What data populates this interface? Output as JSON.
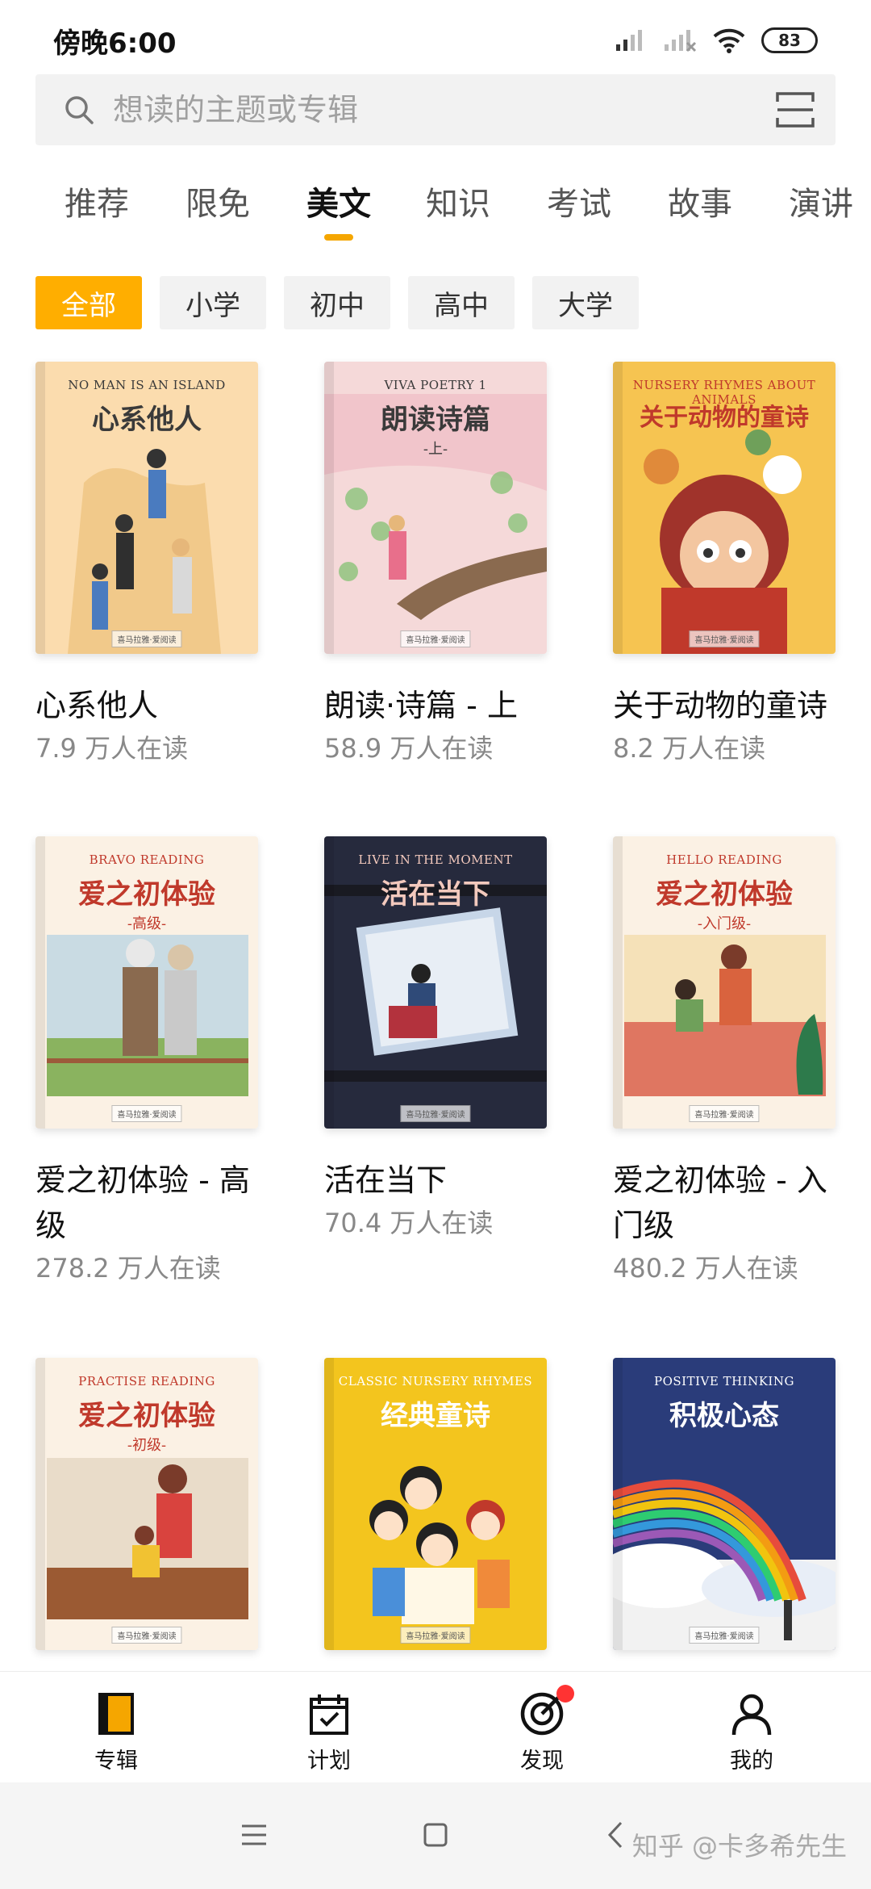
{
  "status": {
    "time": "傍晚6:00",
    "battery": "83"
  },
  "search": {
    "placeholder": "想读的主题或专辑"
  },
  "tabs": [
    {
      "label": "推荐"
    },
    {
      "label": "限免"
    },
    {
      "label": "美文",
      "active": true
    },
    {
      "label": "知识"
    },
    {
      "label": "考试"
    },
    {
      "label": "故事"
    },
    {
      "label": "演讲"
    }
  ],
  "chips": [
    {
      "label": "全部",
      "active": true
    },
    {
      "label": "小学"
    },
    {
      "label": "初中"
    },
    {
      "label": "高中"
    },
    {
      "label": "大学"
    }
  ],
  "books": [
    {
      "title": "心系他人",
      "count": "7.9 万人在读",
      "cover_en": "NO MAN IS AN ISLAND",
      "cover_cn": "心系他人",
      "cover_sub": "",
      "bg": "#fbdcae",
      "fg": "#3a3a3a"
    },
    {
      "title": "朗读·诗篇 - 上",
      "count": "58.9 万人在读",
      "cover_en": "VIVA POETRY 1",
      "cover_cn": "朗读诗篇",
      "cover_sub": "-上-",
      "bg": "#f5d9d9",
      "fg": "#3a3a3a"
    },
    {
      "title": "关于动物的童诗",
      "count": "8.2 万人在读",
      "cover_en": "NURSERY RHYMES ABOUT ANIMALS",
      "cover_cn": "关于动物的童诗",
      "cover_sub": "",
      "bg": "#f6c451",
      "fg": "#c0392b"
    },
    {
      "title": "爱之初体验 - 高级",
      "count": "278.2 万人在读",
      "cover_en": "BRAVO READING",
      "cover_cn": "爱之初体验",
      "cover_sub": "-高级-",
      "bg": "#fbf1e4",
      "fg": "#c0392b"
    },
    {
      "title": "活在当下",
      "count": "70.4 万人在读",
      "cover_en": "LIVE IN THE MOMENT",
      "cover_cn": "活在当下",
      "cover_sub": "",
      "bg": "#262a3d",
      "fg": "#f3c9bd"
    },
    {
      "title": "爱之初体验 - 入门级",
      "count": "480.2 万人在读",
      "cover_en": "HELLO READING",
      "cover_cn": "爱之初体验",
      "cover_sub": "-入门级-",
      "bg": "#fbf1e4",
      "fg": "#c0392b"
    },
    {
      "title": "",
      "count": "",
      "cover_en": "PRACTISE READING",
      "cover_cn": "爱之初体验",
      "cover_sub": "-初级-",
      "bg": "#fbf1e4",
      "fg": "#c0392b"
    },
    {
      "title": "",
      "count": "",
      "cover_en": "CLASSIC NURSERY RHYMES",
      "cover_cn": "经典童诗",
      "cover_sub": "",
      "bg": "#f3c51e",
      "fg": "#ffffff"
    },
    {
      "title": "",
      "count": "",
      "cover_en": "POSITIVE THINKING",
      "cover_cn": "积极心态",
      "cover_sub": "",
      "bg": "#2a3c7a",
      "fg": "#ffffff"
    }
  ],
  "cover_badge": "喜马拉雅·爱阅读",
  "bottom_nav": [
    {
      "label": "专辑",
      "icon": "album-icon",
      "active": true
    },
    {
      "label": "计划",
      "icon": "calendar-check-icon"
    },
    {
      "label": "发现",
      "icon": "target-icon",
      "badge": true
    },
    {
      "label": "我的",
      "icon": "person-icon"
    }
  ],
  "watermark": "知乎 @卡多希先生",
  "colors": {
    "accent": "#ffae00",
    "badge": "#ff3333"
  }
}
